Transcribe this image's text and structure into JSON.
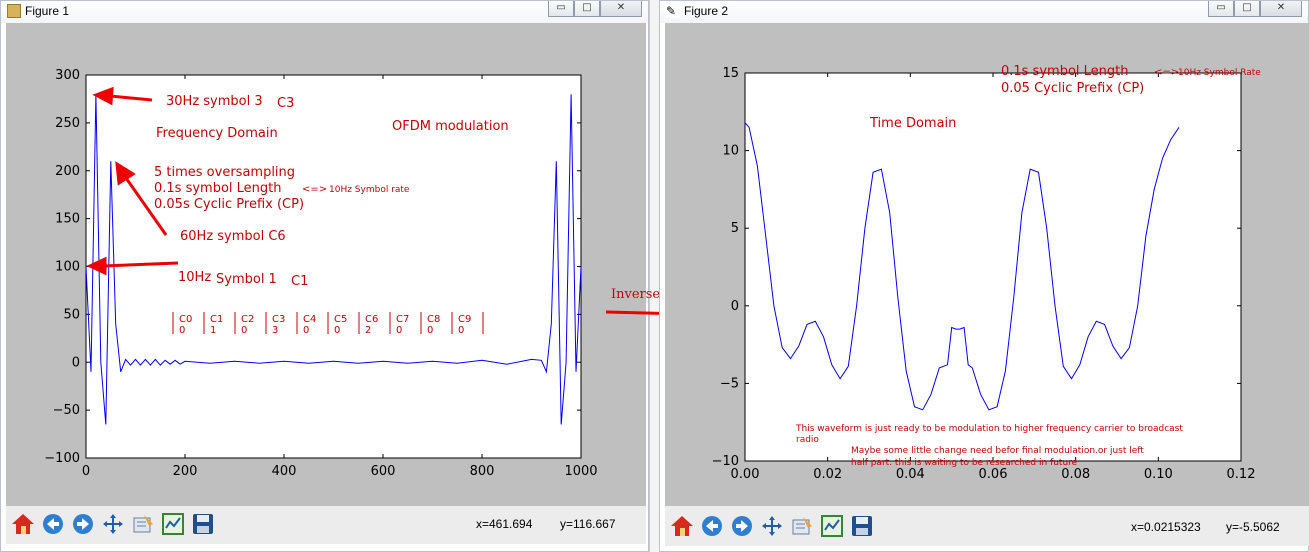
{
  "figure1": {
    "title": "Figure 1",
    "annotations": {
      "sym3": "30Hz symbol 3",
      "sym3_tag": "C3",
      "freq_domain": "Frequency Domain",
      "ofdm": "OFDM modulation",
      "oversampling": "5 times oversampling",
      "sym_length": "0.1s symbol Length",
      "sym_length_arrow": "<=>",
      "sym_rate": "10Hz Symbol rate",
      "cyclic": "0.05s Cyclic Prefix  (CP)",
      "sym6": "60Hz symbol C6",
      "sym1": "10Hz",
      "sym1_b": "Symbol 1",
      "sym1_tag": "C1"
    },
    "table": {
      "headers": [
        "C0",
        "C1",
        "C2",
        "C3",
        "C4",
        "C5",
        "C6",
        "C7",
        "C8",
        "C9"
      ],
      "values": [
        "0",
        "1",
        "0",
        "3",
        "0",
        "0",
        "2",
        "0",
        "0",
        "0"
      ]
    },
    "coord_x": "x=461.694",
    "coord_y": "y=116.667"
  },
  "figure2": {
    "title": "Figure 2",
    "annotations": {
      "sym_length": "0.1s symbol Length",
      "sym_length_arrow": "<=>",
      "sym_rate": "10Hz Symbol Rate",
      "cyclic": "0.05 Cyclic Prefix (CP)",
      "time_domain": "Time Domain",
      "note1": "This waveform is just ready to be modulation to higher frequency carrier to broadcast",
      "note1b": "radio",
      "note2": "Maybe some little change need befor final modulation.or just left",
      "note2b": "half part. this is waiting to be researched in future"
    },
    "coord_x": "x=0.0215323",
    "coord_y": "y=-5.5062"
  },
  "between": {
    "inverse_fft": "Inverse FFT"
  },
  "toolbar_icons": [
    "home-icon",
    "back-icon",
    "forward-icon",
    "pan-icon",
    "zoom-icon",
    "subplots-icon",
    "save-icon"
  ],
  "window_buttons": {
    "minimize": "▭",
    "maximize": "□",
    "close": "✕"
  },
  "colors": {
    "line": "#0000ff",
    "annotation": "#cc0000",
    "arrow": "#ee0000",
    "canvas": "#bfbfbf",
    "toolbar": "#ececec"
  },
  "chart_data": [
    {
      "type": "line",
      "title": "",
      "xlabel": "",
      "ylabel": "",
      "xlim": [
        0,
        1000
      ],
      "ylim": [
        -100,
        300
      ],
      "xticks": [
        "0",
        "200",
        "400",
        "600",
        "800",
        "1000"
      ],
      "yticks": [
        "−100",
        "−50",
        "0",
        "50",
        "100",
        "150",
        "200",
        "250",
        "300"
      ],
      "series": [
        {
          "x": [
            0,
            10,
            20,
            30,
            40,
            50,
            60,
            70,
            80,
            90,
            100,
            110,
            120,
            130,
            140,
            150,
            160,
            170,
            180,
            190,
            200,
            250,
            300,
            350,
            400,
            450,
            500,
            550,
            600,
            650,
            700,
            750,
            800,
            850,
            900,
            920,
            930,
            940,
            950,
            960,
            970,
            980,
            990,
            1000
          ],
          "y": [
            100,
            -10,
            280,
            0,
            -65,
            210,
            40,
            -10,
            3,
            -3,
            3,
            -3,
            3,
            -3,
            3,
            -3,
            2,
            -2,
            2,
            -2,
            1,
            -1,
            1,
            -1,
            1,
            -1,
            1,
            -1,
            1,
            -1,
            1,
            -1,
            2,
            -2,
            3,
            2,
            -10,
            40,
            210,
            -65,
            0,
            280,
            -10,
            100
          ]
        }
      ]
    },
    {
      "type": "line",
      "title": "",
      "xlabel": "",
      "ylabel": "",
      "xlim": [
        0.0,
        0.12
      ],
      "ylim": [
        -10,
        15
      ],
      "xticks": [
        "0.00",
        "0.02",
        "0.04",
        "0.06",
        "0.08",
        "0.10",
        "0.12"
      ],
      "yticks": [
        "−10",
        "−5",
        "0",
        "5",
        "10",
        "15"
      ],
      "series": [
        {
          "x": [
            0.0,
            0.001,
            0.003,
            0.005,
            0.007,
            0.009,
            0.011,
            0.013,
            0.015,
            0.017,
            0.019,
            0.021,
            0.023,
            0.025,
            0.027,
            0.029,
            0.031,
            0.033,
            0.035,
            0.037,
            0.039,
            0.041,
            0.043,
            0.045,
            0.047,
            0.049,
            0.05,
            0.051,
            0.052,
            0.053,
            0.054,
            0.055,
            0.057,
            0.059,
            0.061,
            0.063,
            0.065,
            0.067,
            0.069,
            0.071,
            0.073,
            0.075,
            0.077,
            0.079,
            0.081,
            0.083,
            0.085,
            0.087,
            0.089,
            0.091,
            0.093,
            0.095,
            0.097,
            0.099,
            0.101,
            0.103,
            0.105
          ],
          "y": [
            11.8,
            11.5,
            9.0,
            4.5,
            0.0,
            -2.7,
            -3.4,
            -2.6,
            -1.2,
            -1.0,
            -2.0,
            -3.8,
            -4.7,
            -3.9,
            0.0,
            5.0,
            8.6,
            8.8,
            6.0,
            0.5,
            -4.2,
            -6.5,
            -6.7,
            -5.7,
            -4.0,
            -3.8,
            -1.4,
            -1.5,
            -1.5,
            -1.4,
            -3.8,
            -4.0,
            -5.7,
            -6.7,
            -6.5,
            -4.2,
            0.5,
            6.0,
            8.8,
            8.6,
            5.0,
            0.0,
            -3.9,
            -4.7,
            -3.8,
            -2.0,
            -1.0,
            -1.2,
            -2.6,
            -3.4,
            -2.7,
            0.0,
            4.5,
            7.5,
            9.5,
            10.7,
            11.5
          ]
        }
      ]
    }
  ]
}
